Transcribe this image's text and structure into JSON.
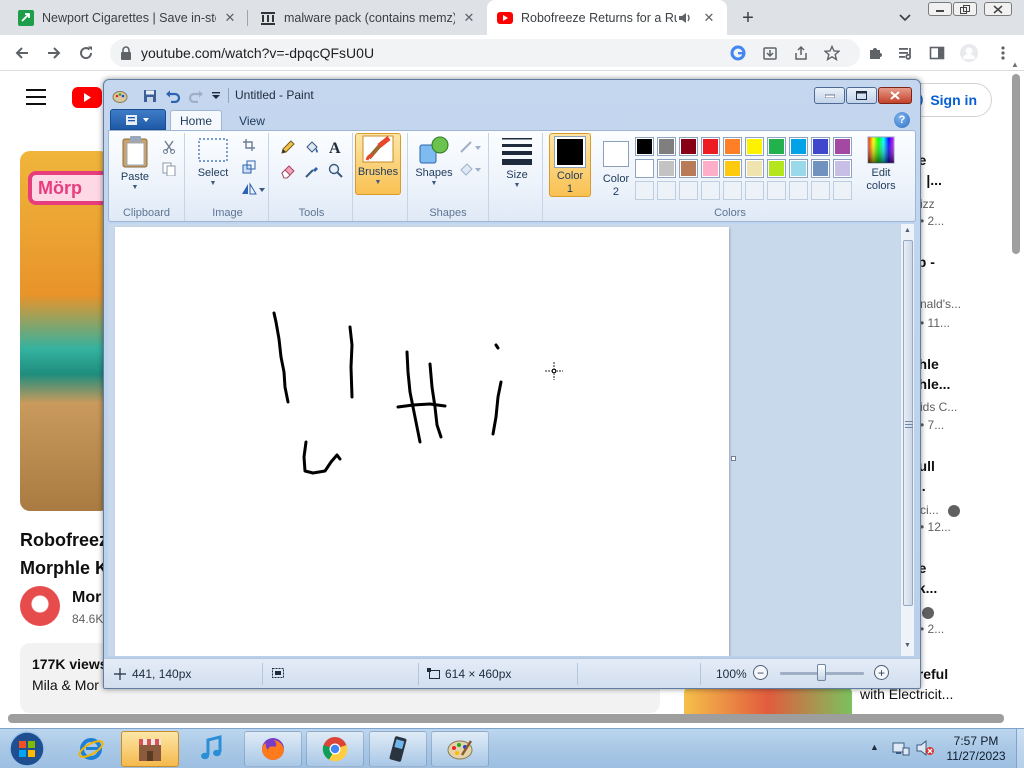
{
  "browser": {
    "tabs": [
      {
        "title": "Newport Cigarettes | Save in-sto"
      },
      {
        "title": "malware pack (contains memz) :"
      },
      {
        "title": "Robofreeze Returns for a Ru"
      }
    ],
    "url": "youtube.com/watch?v=-dpqcQFsU0U"
  },
  "youtube": {
    "sign_in": "Sign in",
    "video_title_line1": "Robofreez",
    "video_title_line2": "Morphle K",
    "thumb_sign": "Mörp",
    "channel_name": "Mor",
    "subscribers": "84.6K",
    "views": "177K views",
    "desc": "Mila & Mor",
    "recommendations": [
      {
        "line1": "he",
        "line2": "e! |...",
        "meta1": "izz",
        "meta2": "• 2..."
      },
      {
        "line1": "ap -",
        "line2": "",
        "meta1": "nald's...",
        "meta2": "• 11..."
      },
      {
        "line1": "ohle",
        "line2": "ohle...",
        "meta1": "ids C...",
        "meta2": "• 7..."
      },
      {
        "line1": "Full",
        "line2": "|...",
        "meta1": "ci...",
        "meta2": "• 12..."
      },
      {
        "line1": "he",
        "line2": "ck...",
        "meta1": "",
        "meta2": "• 2..."
      },
      {
        "line1": "areful",
        "line2": "with Electricit...",
        "meta1": "",
        "meta2": ""
      }
    ]
  },
  "paint": {
    "window_title": "Untitled - Paint",
    "tabs": {
      "home": "Home",
      "view": "View"
    },
    "groups": {
      "clipboard": {
        "label": "Clipboard",
        "paste": "Paste"
      },
      "image": {
        "label": "Image",
        "select": "Select"
      },
      "tools": {
        "label": "Tools"
      },
      "brushes": {
        "label": "Brushes"
      },
      "shapes": {
        "label": "Shapes",
        "shapes_btn": "Shapes"
      },
      "size": {
        "label": "Size"
      },
      "colors": {
        "label": "Colors",
        "color1": "Color",
        "color1_num": "1",
        "color2": "Color",
        "color2_num": "2",
        "edit_colors_1": "Edit",
        "edit_colors_2": "colors"
      }
    },
    "color1_value": "#000000",
    "color2_value": "#ffffff",
    "palette_row1": [
      "#000000",
      "#7f7f7f",
      "#880015",
      "#ed1c24",
      "#ff7f27",
      "#fff200",
      "#22b14c",
      "#00a2e8",
      "#3f48cc",
      "#a349a4"
    ],
    "palette_row2": [
      "#ffffff",
      "#c3c3c3",
      "#b97a57",
      "#ffaec9",
      "#ffc90e",
      "#efe4b0",
      "#b5e61d",
      "#99d9ea",
      "#7092be",
      "#c8bfe7"
    ],
    "status": {
      "cursor_pos": "441, 140px",
      "image_size": "614 × 460px",
      "zoom": "100%"
    },
    "zoom_fraction": 0.5
  },
  "taskbar": {
    "time": "7:57 PM",
    "date": "11/27/2023"
  },
  "colors": {
    "chrome_tab_strip": "#dee1e6",
    "youtube_red": "#ff0000",
    "paint_frame": "#c4d7ef"
  }
}
